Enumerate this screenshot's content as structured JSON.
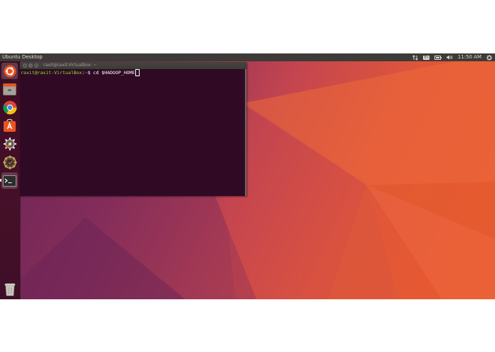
{
  "top_panel": {
    "title": "Ubuntu Desktop",
    "keyboard_layout": "En",
    "time": "11:50 AM"
  },
  "launcher": {
    "items": [
      {
        "name": "dash-home",
        "icon": "ubuntu-logo-icon"
      },
      {
        "name": "files",
        "icon": "files-icon"
      },
      {
        "name": "chrome",
        "icon": "chrome-icon"
      },
      {
        "name": "software-center",
        "icon": "software-center-icon"
      },
      {
        "name": "system-settings",
        "icon": "settings-icon"
      },
      {
        "name": "software-updater",
        "icon": "updater-icon"
      },
      {
        "name": "terminal",
        "icon": "terminal-icon"
      },
      {
        "name": "trash",
        "icon": "trash-icon"
      }
    ]
  },
  "terminal": {
    "title": "raxit@raxit-VirtualBox: ~",
    "prompt_user": "raxit@raxit-VirtualBox",
    "prompt_sep": ":",
    "prompt_path": "~",
    "prompt_symbol": "$",
    "command": "cd $HADOOP_HOME"
  },
  "colors": {
    "panel": "#3c3b37",
    "launcher": "#3f0e26",
    "terminal_bg": "#300a24",
    "prompt_user": "#8ae234",
    "prompt_path": "#729fcf",
    "wallpaper_orange": "#e95a2c",
    "wallpaper_purple": "#5c1f4e"
  }
}
